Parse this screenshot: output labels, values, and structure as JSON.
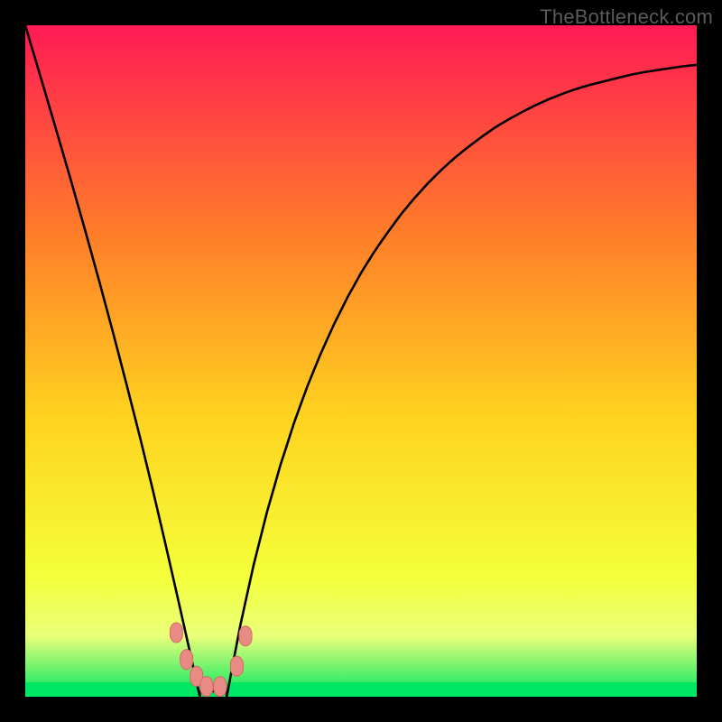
{
  "watermark": "TheBottleneck.com",
  "colors": {
    "frame_bg": "#000000",
    "gradient_top": "#ff1a54",
    "gradient_upper_mid": "#ff7a2a",
    "gradient_mid": "#ffd21f",
    "gradient_lower_mid": "#f4ff3a",
    "gradient_band": "#e9ff7a",
    "gradient_bottom": "#00e763",
    "curve": "#000000",
    "marker_fill": "#e98b85",
    "marker_stroke": "#d46a63"
  },
  "chart_data": {
    "type": "line",
    "title": "",
    "xlabel": "",
    "ylabel": "",
    "x": [
      0.0,
      0.02,
      0.04,
      0.06,
      0.08,
      0.1,
      0.12,
      0.14,
      0.16,
      0.18,
      0.2,
      0.22,
      0.24,
      0.26,
      0.28,
      0.3,
      0.32,
      0.34,
      0.36,
      0.38,
      0.4,
      0.42,
      0.44,
      0.46,
      0.48,
      0.5,
      0.52,
      0.54,
      0.56,
      0.58,
      0.6,
      0.62,
      0.64,
      0.66,
      0.68,
      0.7,
      0.72,
      0.74,
      0.76,
      0.78,
      0.8,
      0.82,
      0.84,
      0.86,
      0.88,
      0.9,
      0.92,
      0.94,
      0.96,
      0.98,
      1.0
    ],
    "series": [
      {
        "name": "left_branch",
        "x_range": [
          0.0,
          0.26
        ],
        "values": [
          100.0,
          92.3,
          84.6,
          76.9,
          69.2,
          61.5,
          53.8,
          46.1,
          38.5,
          30.8,
          23.1,
          15.4,
          7.7,
          0.0
        ]
      },
      {
        "name": "right_branch",
        "x_range": [
          0.3,
          1.0
        ],
        "values": [
          0.0,
          10.5,
          19.6,
          27.5,
          34.5,
          40.7,
          46.2,
          51.1,
          55.5,
          59.5,
          63.1,
          66.3,
          69.2,
          71.9,
          74.3,
          76.5,
          78.5,
          80.3,
          81.9,
          83.4,
          84.8,
          86.0,
          87.1,
          88.1,
          89.0,
          89.8,
          90.5,
          91.1,
          91.6,
          92.1,
          92.6,
          93.0,
          93.3,
          93.6,
          93.9,
          94.1
        ]
      }
    ],
    "xlim": [
      0,
      1
    ],
    "ylim": [
      0,
      100
    ],
    "markers": [
      {
        "x": 0.225,
        "y": 9.0
      },
      {
        "x": 0.24,
        "y": 5.0
      },
      {
        "x": 0.255,
        "y": 2.5
      },
      {
        "x": 0.27,
        "y": 1.0
      },
      {
        "x": 0.29,
        "y": 1.0
      },
      {
        "x": 0.315,
        "y": 4.0
      },
      {
        "x": 0.328,
        "y": 8.5
      }
    ]
  }
}
